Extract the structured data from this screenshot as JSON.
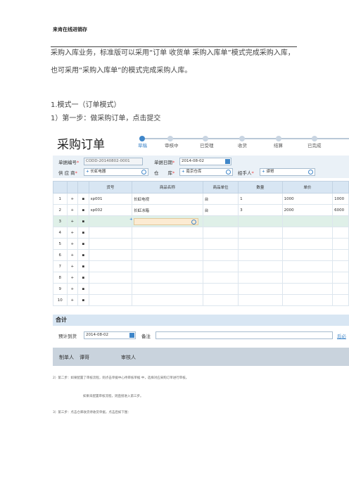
{
  "document": {
    "title": "来肯在线进销存",
    "para1_line1": "采购入库业务，标准版可以采用“订单 收货单 采购入库单”模式完成采购入库，",
    "para1_line2": "也可采用“采购入库单”的模式完成采购人库。",
    "section": "1.模式一（订单模式）",
    "step1": "1）第一步：做采购订单，点击提交",
    "step2": "2）第二步：如果配置了审核流程，则点击单据中心待审核单据 中，选择对应采购订单进行审核。",
    "step2_note": "如果未配置审核流程，则直接进入第三步。",
    "step3": "3）第三步：点击仓库收货待收货单据，点击后如下图："
  },
  "po": {
    "title": "采购订单",
    "steps": [
      {
        "label": "草稿",
        "active": true
      },
      {
        "label": "审核中",
        "active": false
      },
      {
        "label": "已受理",
        "active": false
      },
      {
        "label": "收货",
        "active": false
      },
      {
        "label": "结算",
        "active": false
      },
      {
        "label": "已完成",
        "active": false
      }
    ],
    "form": {
      "doc_no_label": "单据编号",
      "doc_no": "CODD-20140802-0001",
      "date_label": "单据日期",
      "date": "2014-08-02",
      "supplier_label": "供 应 商",
      "supplier": "长虹电器",
      "warehouse_label": "仓　　库",
      "warehouse": "南京仓库",
      "handler_label": "经手人",
      "handler": "谭哥"
    },
    "columns": [
      "货号",
      "商品名称",
      "商品单位",
      "数量",
      "单价"
    ],
    "rows": [
      {
        "n": "1",
        "sku": "sp001",
        "name": "长虹电视",
        "unit": "台",
        "qty": "1",
        "price": "1000",
        "amount": "1000"
      },
      {
        "n": "2",
        "sku": "sp002",
        "name": "长虹冰箱",
        "unit": "台",
        "qty": "3",
        "price": "2000",
        "amount": "6000"
      },
      {
        "n": "3",
        "sku": "",
        "name": "",
        "unit": "",
        "qty": "",
        "price": "",
        "amount": ""
      },
      {
        "n": "4",
        "sku": "",
        "name": "",
        "unit": "",
        "qty": "",
        "price": "",
        "amount": ""
      },
      {
        "n": "5",
        "sku": "",
        "name": "",
        "unit": "",
        "qty": "",
        "price": "",
        "amount": ""
      },
      {
        "n": "6",
        "sku": "",
        "name": "",
        "unit": "",
        "qty": "",
        "price": "",
        "amount": ""
      },
      {
        "n": "7",
        "sku": "",
        "name": "",
        "unit": "",
        "qty": "",
        "price": "",
        "amount": ""
      },
      {
        "n": "8",
        "sku": "",
        "name": "",
        "unit": "",
        "qty": "",
        "price": "",
        "amount": ""
      },
      {
        "n": "9",
        "sku": "",
        "name": "",
        "unit": "",
        "qty": "",
        "price": "",
        "amount": ""
      },
      {
        "n": "10",
        "sku": "",
        "name": "",
        "unit": "",
        "qty": "",
        "price": "",
        "amount": ""
      }
    ],
    "total_label": "合计",
    "delivery_label": "预计到货",
    "delivery_date": "2014-08-02",
    "remark_label": "备注",
    "more_link": "后必",
    "creator_label": "制单人",
    "creator": "谭哥",
    "reviewer_label": "审核人"
  },
  "colors": {
    "accent": "#3f86c9",
    "header_bg": "#d8e6f3",
    "highlight_row": "#dff0e8",
    "footer_bg": "#c9d3dd"
  }
}
